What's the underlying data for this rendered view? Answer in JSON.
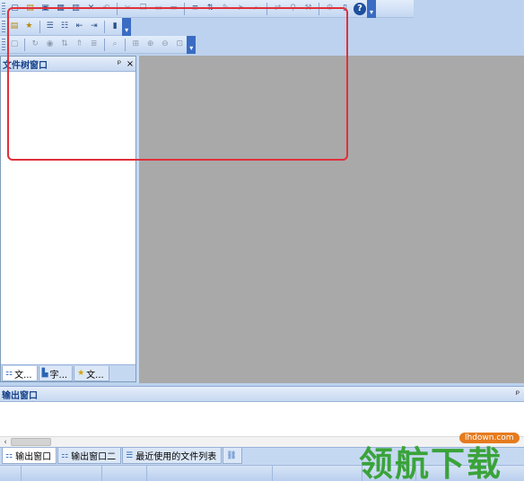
{
  "toolbars": {
    "row1": [
      "new-file-icon",
      "open-folder-icon",
      "save-icon",
      "save-all-icon",
      "print-icon",
      "close-icon",
      "undo-icon",
      "cut-icon",
      "copy-icon",
      "paste-icon",
      "delete-icon",
      "format-icon",
      "sort-icon",
      "bookmark-icon",
      "forward-icon",
      "find-icon",
      "replace-icon",
      "filter-icon",
      "tools-icon",
      "window-icon",
      "help-icon"
    ],
    "row2": [
      "folder-yellow-icon",
      "star-folder-icon",
      "list-icon",
      "list-alt-icon",
      "outdent-icon",
      "indent-icon",
      "attach-icon"
    ],
    "row3": [
      "text-icon",
      "refresh-icon",
      "globe-icon",
      "sort-az-icon",
      "sort-up-icon",
      "sort-list-icon",
      "preview-icon",
      "expand-icon",
      "zoom-in-icon",
      "zoom-out-icon",
      "fit-icon"
    ]
  },
  "left_panel": {
    "title": "文件树窗口",
    "pin": "ᵖ",
    "close": "×",
    "tabs": [
      {
        "label": "文...",
        "icon": "tree-icon"
      },
      {
        "label": "字...",
        "icon": "chart-icon"
      },
      {
        "label": "文...",
        "icon": "star-icon"
      }
    ]
  },
  "output_panel": {
    "title": "输出窗口",
    "pin": "ᵖ"
  },
  "output_tabs": [
    {
      "label": "输出窗口",
      "icon": "tree-icon"
    },
    {
      "label": "输出窗口二",
      "icon": "tree-icon"
    },
    {
      "label": "最近使用的文件列表",
      "icon": "list-icon"
    },
    {
      "label": "",
      "icon": "link-icon"
    }
  ],
  "watermark": {
    "text": "领航下载",
    "site": "lhdown.com"
  },
  "colors": {
    "highlight": "#e0303a",
    "workarea": "#a9a9a9",
    "chrome": "#c5d8f2"
  }
}
